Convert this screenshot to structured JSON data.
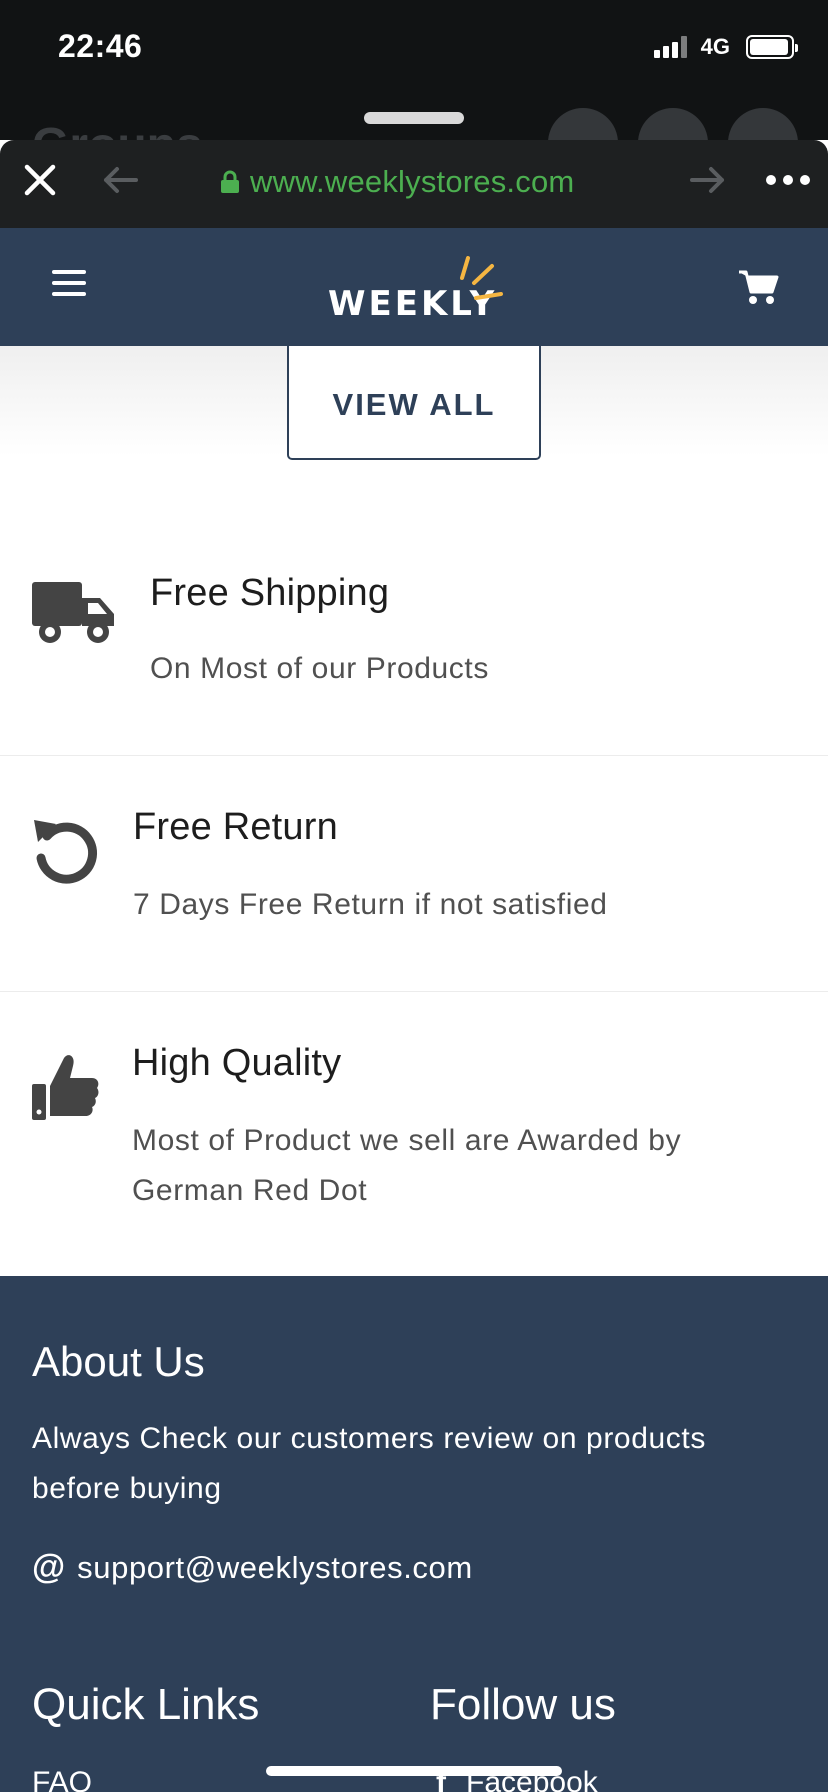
{
  "status_bar": {
    "time": "22:46",
    "network": "4G"
  },
  "browser": {
    "url": "www.weeklystores.com",
    "url_color": "#4caf50"
  },
  "header": {
    "logo_text": "WEEKLY",
    "brand_color": "#2e4058",
    "accent_color": "#f5b642"
  },
  "view_all": {
    "label": "VIEW ALL"
  },
  "features": [
    {
      "icon": "truck-icon",
      "title": "Free Shipping",
      "subtitle": "On Most of our Products"
    },
    {
      "icon": "return-icon",
      "title": "Free Return",
      "subtitle": "7 Days Free Return if not satisfied"
    },
    {
      "icon": "thumbs-up-icon",
      "title": "High Quality",
      "subtitle": "Most of Product we sell are Awarded by German Red Dot"
    }
  ],
  "footer": {
    "about_title": "About Us",
    "about_text": "Always Check our customers review on products before buying",
    "email_icon": "@",
    "email": "support@weeklystores.com",
    "quick_links_title": "Quick Links",
    "follow_title": "Follow us",
    "quick_links": [
      "FAQ"
    ],
    "social": [
      {
        "icon": "facebook-icon",
        "label": "Facebook"
      }
    ]
  }
}
